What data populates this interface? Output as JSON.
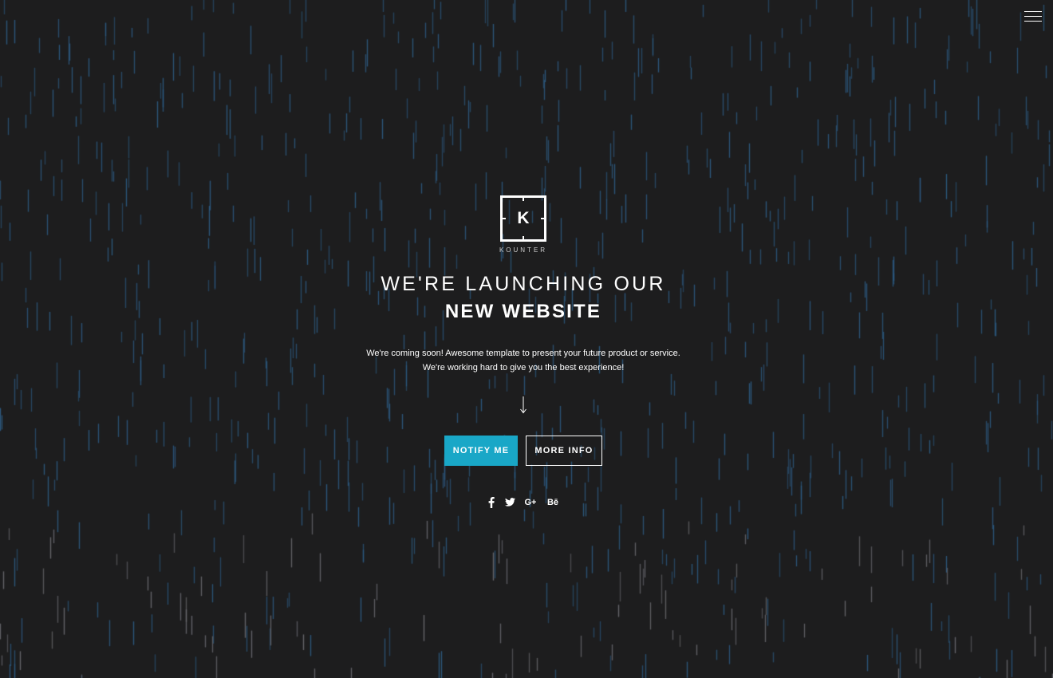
{
  "brand": {
    "logo_letter": "K",
    "name": "KOUNTER"
  },
  "hero": {
    "title_line1": "WE'RE LAUNCHING OUR",
    "title_line2": "NEW WEBSITE",
    "description_line1": "We're coming soon! Awesome template to present your future product or service.",
    "description_line2": "We're working hard to give you the best experience!"
  },
  "buttons": {
    "notify_label": "NOTIFY ME",
    "more_info_label": "MORE INFO"
  },
  "social": [
    {
      "icon": "facebook-icon",
      "glyph": "f"
    },
    {
      "icon": "twitter-icon",
      "glyph": "t"
    },
    {
      "icon": "google-plus-icon",
      "glyph": "G+"
    },
    {
      "icon": "behance-icon",
      "glyph": "Bē"
    }
  ],
  "colors": {
    "background": "#1d1d1e",
    "accent": "#19a7c7",
    "rain_blue": "#2d5d86",
    "rain_grey": "#6d6d73"
  }
}
